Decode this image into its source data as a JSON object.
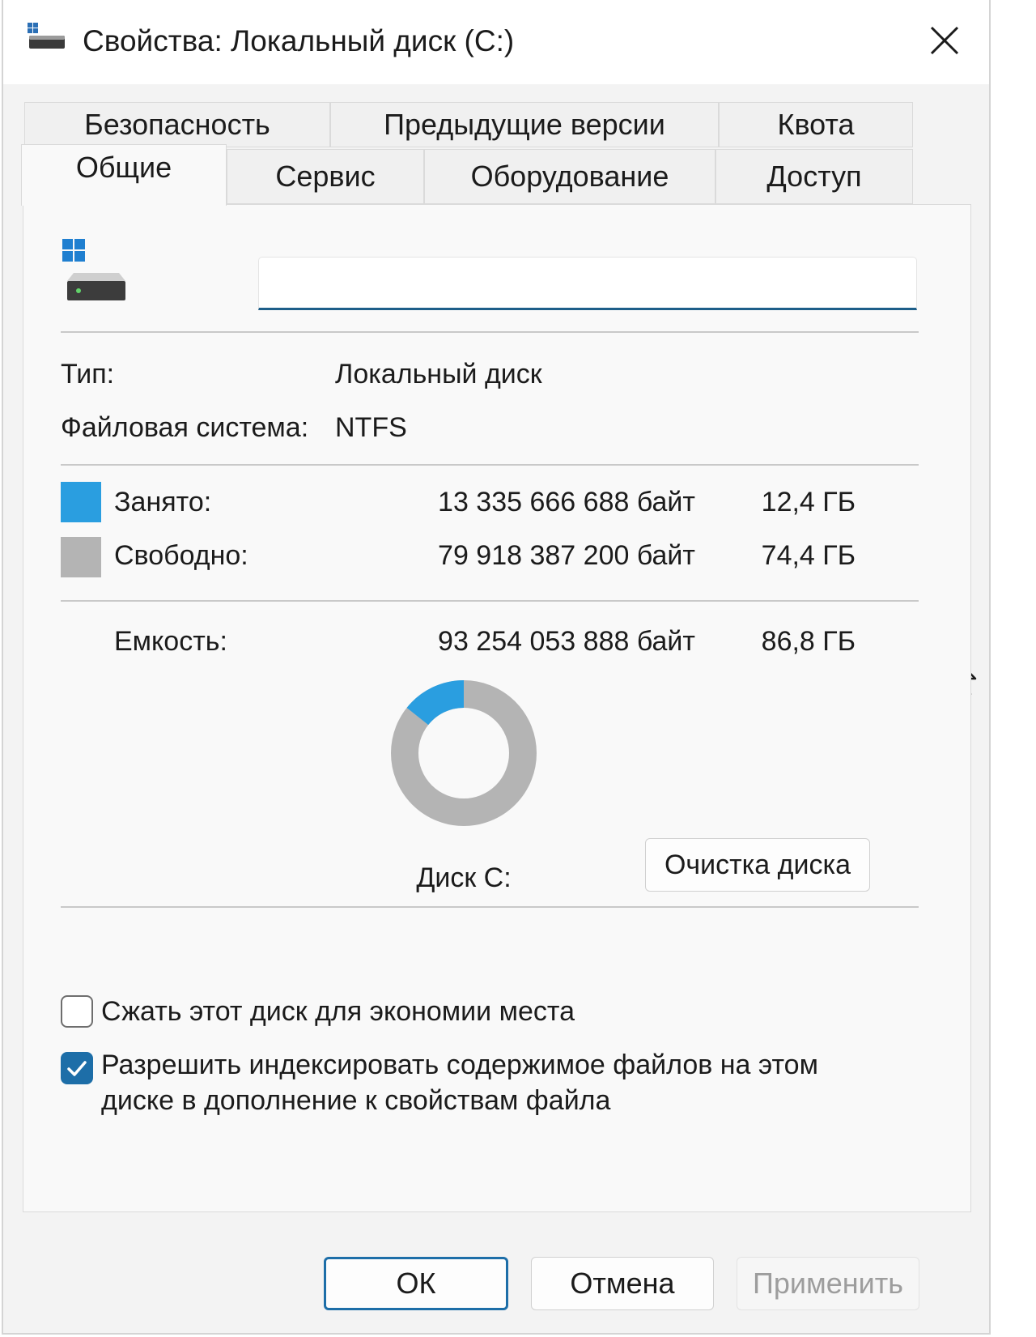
{
  "window": {
    "title": "Свойства: Локальный диск (C:)",
    "close_icon": "close-icon"
  },
  "tabs_row1": [
    {
      "label": "Безопасность"
    },
    {
      "label": "Предыдущие версии"
    },
    {
      "label": "Квота"
    }
  ],
  "tabs_row2": [
    {
      "label": "Общие",
      "active": true
    },
    {
      "label": "Сервис"
    },
    {
      "label": "Оборудование"
    },
    {
      "label": "Доступ"
    }
  ],
  "general": {
    "volume_label_value": "",
    "type_label": "Тип:",
    "type_value": "Локальный диск",
    "fs_label": "Файловая система:",
    "fs_value": "NTFS",
    "used": {
      "label": "Занято:",
      "bytes": "13 335 666 688 байт",
      "size": "12,4 ГБ",
      "color": "#2a9ee0"
    },
    "free": {
      "label": "Свободно:",
      "bytes": "79 918 387 200 байт",
      "size": "74,4 ГБ",
      "color": "#b4b4b4"
    },
    "capacity": {
      "label": "Емкость:",
      "bytes": "93 254 053 888 байт",
      "size": "86,8 ГБ"
    },
    "disk_name": "Диск C:",
    "cleanup_button": "Очистка диска",
    "used_fraction": 0.143,
    "compress_checkbox": {
      "label": "Сжать этот диск для экономии места",
      "checked": false
    },
    "index_checkbox": {
      "label": "Разрешить индексировать содержимое файлов на этом диске в дополнение к свойствам файла",
      "checked": true
    }
  },
  "footer": {
    "ok": "ОК",
    "cancel": "Отмена",
    "apply": "Применить"
  },
  "colors": {
    "accent": "#1d6ea8",
    "used": "#2a9ee0",
    "free": "#b4b4b4"
  }
}
